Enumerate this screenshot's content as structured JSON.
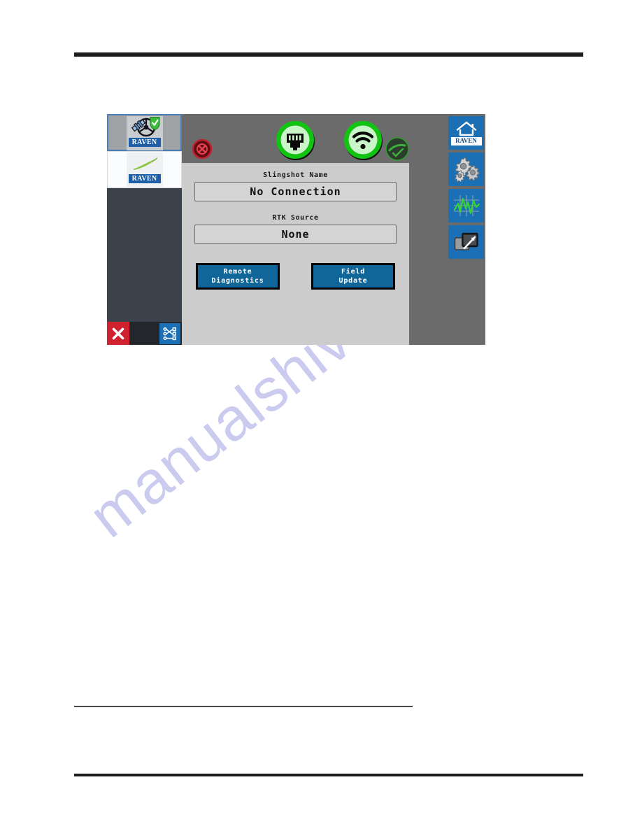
{
  "page": {
    "watermark": "manualshive.com"
  },
  "device_screen": {
    "left_column": {
      "tiles": [
        {
          "name": "gps-machine-tile",
          "brand_label": "RAVEN",
          "icon": "satellite-steering-check-icon",
          "selected": true
        },
        {
          "name": "field-path-tile",
          "brand_label": "RAVEN",
          "icon": "field-swoosh-icon",
          "selected": false
        }
      ],
      "bottom_bar": {
        "close_label": "✕",
        "close_icon": "close-x-icon",
        "topology_icon": "network-topology-icon"
      }
    },
    "status_icons": [
      {
        "name": "satellite-no-signal-icon",
        "state": "error",
        "color": "#c0212e"
      },
      {
        "name": "ethernet-connected-icon",
        "state": "ok",
        "color": "#12c312"
      },
      {
        "name": "wifi-connected-icon",
        "state": "ok",
        "color": "#12c312"
      },
      {
        "name": "cloud-check-icon",
        "state": "ok-dim",
        "color": "#2f7a2f"
      }
    ],
    "toolbar": [
      {
        "name": "home-button",
        "icon": "home-icon",
        "label": "RAVEN"
      },
      {
        "name": "settings-button",
        "icon": "gears-icon",
        "label": ""
      },
      {
        "name": "diagnostics-button",
        "icon": "waveform-graph-icon",
        "label": ""
      },
      {
        "name": "screen-switch-button",
        "icon": "window-switch-icon",
        "label": ""
      }
    ],
    "dialog": {
      "slingshot_name_label": "Slingshot Name",
      "slingshot_name_value": "No Connection",
      "rtk_source_label": "RTK Source",
      "rtk_source_value": "None",
      "remote_diagnostics_button": "Remote\nDiagnostics",
      "field_update_button": "Field\nUpdate"
    }
  },
  "colors": {
    "screen_background": "#6b6b6b",
    "panel_background": "#cccccc",
    "sidebar_dark": "#3c424c",
    "accent_blue": "#1a6fb5",
    "button_blue": "#116699",
    "status_green": "#12c312",
    "status_red": "#c0212e",
    "close_red": "#cf2130"
  }
}
